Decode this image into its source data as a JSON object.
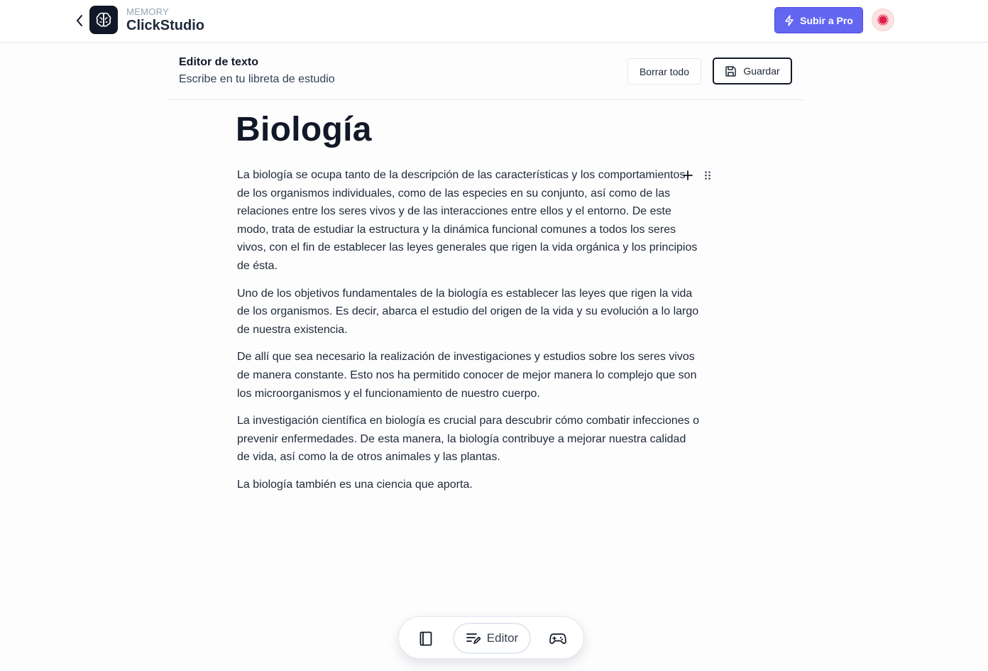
{
  "header": {
    "brand_small": "MEMORY",
    "brand_name": "ClickStudio",
    "upgrade_label": "Subir a Pro"
  },
  "editor": {
    "title": "Editor de texto",
    "subtitle": "Escribe en tu libreta de estudio",
    "clear_label": "Borrar todo",
    "save_label": "Guardar"
  },
  "document": {
    "heading": "Biología",
    "paragraphs": [
      "La biología se ocupa tanto de la descripción de las características y los comportamientos de los organismos individuales, como de las especies en su conjunto, así como de las relaciones entre los seres vivos y de las interacciones entre ellos y el entorno. De este modo, trata de estudiar la estructura y la dinámica funcional comunes a todos los seres vivos, con el fin de establecer las leyes generales que rigen la vida orgánica y los principios de ésta.",
      "Uno de los objetivos fundamentales de la biología es establecer las leyes que rigen la vida de los organismos. Es decir, abarca el estudio del origen de la vida y su evolución a lo largo de nuestra existencia.",
      "De allí que sea necesario la realización de investigaciones y estudios sobre los seres vivos de manera constante. Esto nos ha permitido conocer de mejor manera lo complejo que son los microorganismos y el funcionamiento de nuestro cuerpo.",
      "La investigación científica en biología es crucial para descubrir cómo combatir infecciones o prevenir enfermedades. De esta manera, la biología contribuye a mejorar nuestra calidad de vida, así como la de otros animales y las plantas.",
      "La biología también es una ciencia que aporta."
    ]
  },
  "dock": {
    "editor_label": "Editor"
  },
  "colors": {
    "accent": "#6366f1",
    "dark": "#111827"
  },
  "icons": [
    "chevron-left-icon",
    "brain-icon",
    "lightning-icon",
    "avatar-icon",
    "save-icon",
    "plus-icon",
    "drag-handle-icon",
    "notebook-icon",
    "edit-text-icon",
    "gamepad-icon"
  ]
}
